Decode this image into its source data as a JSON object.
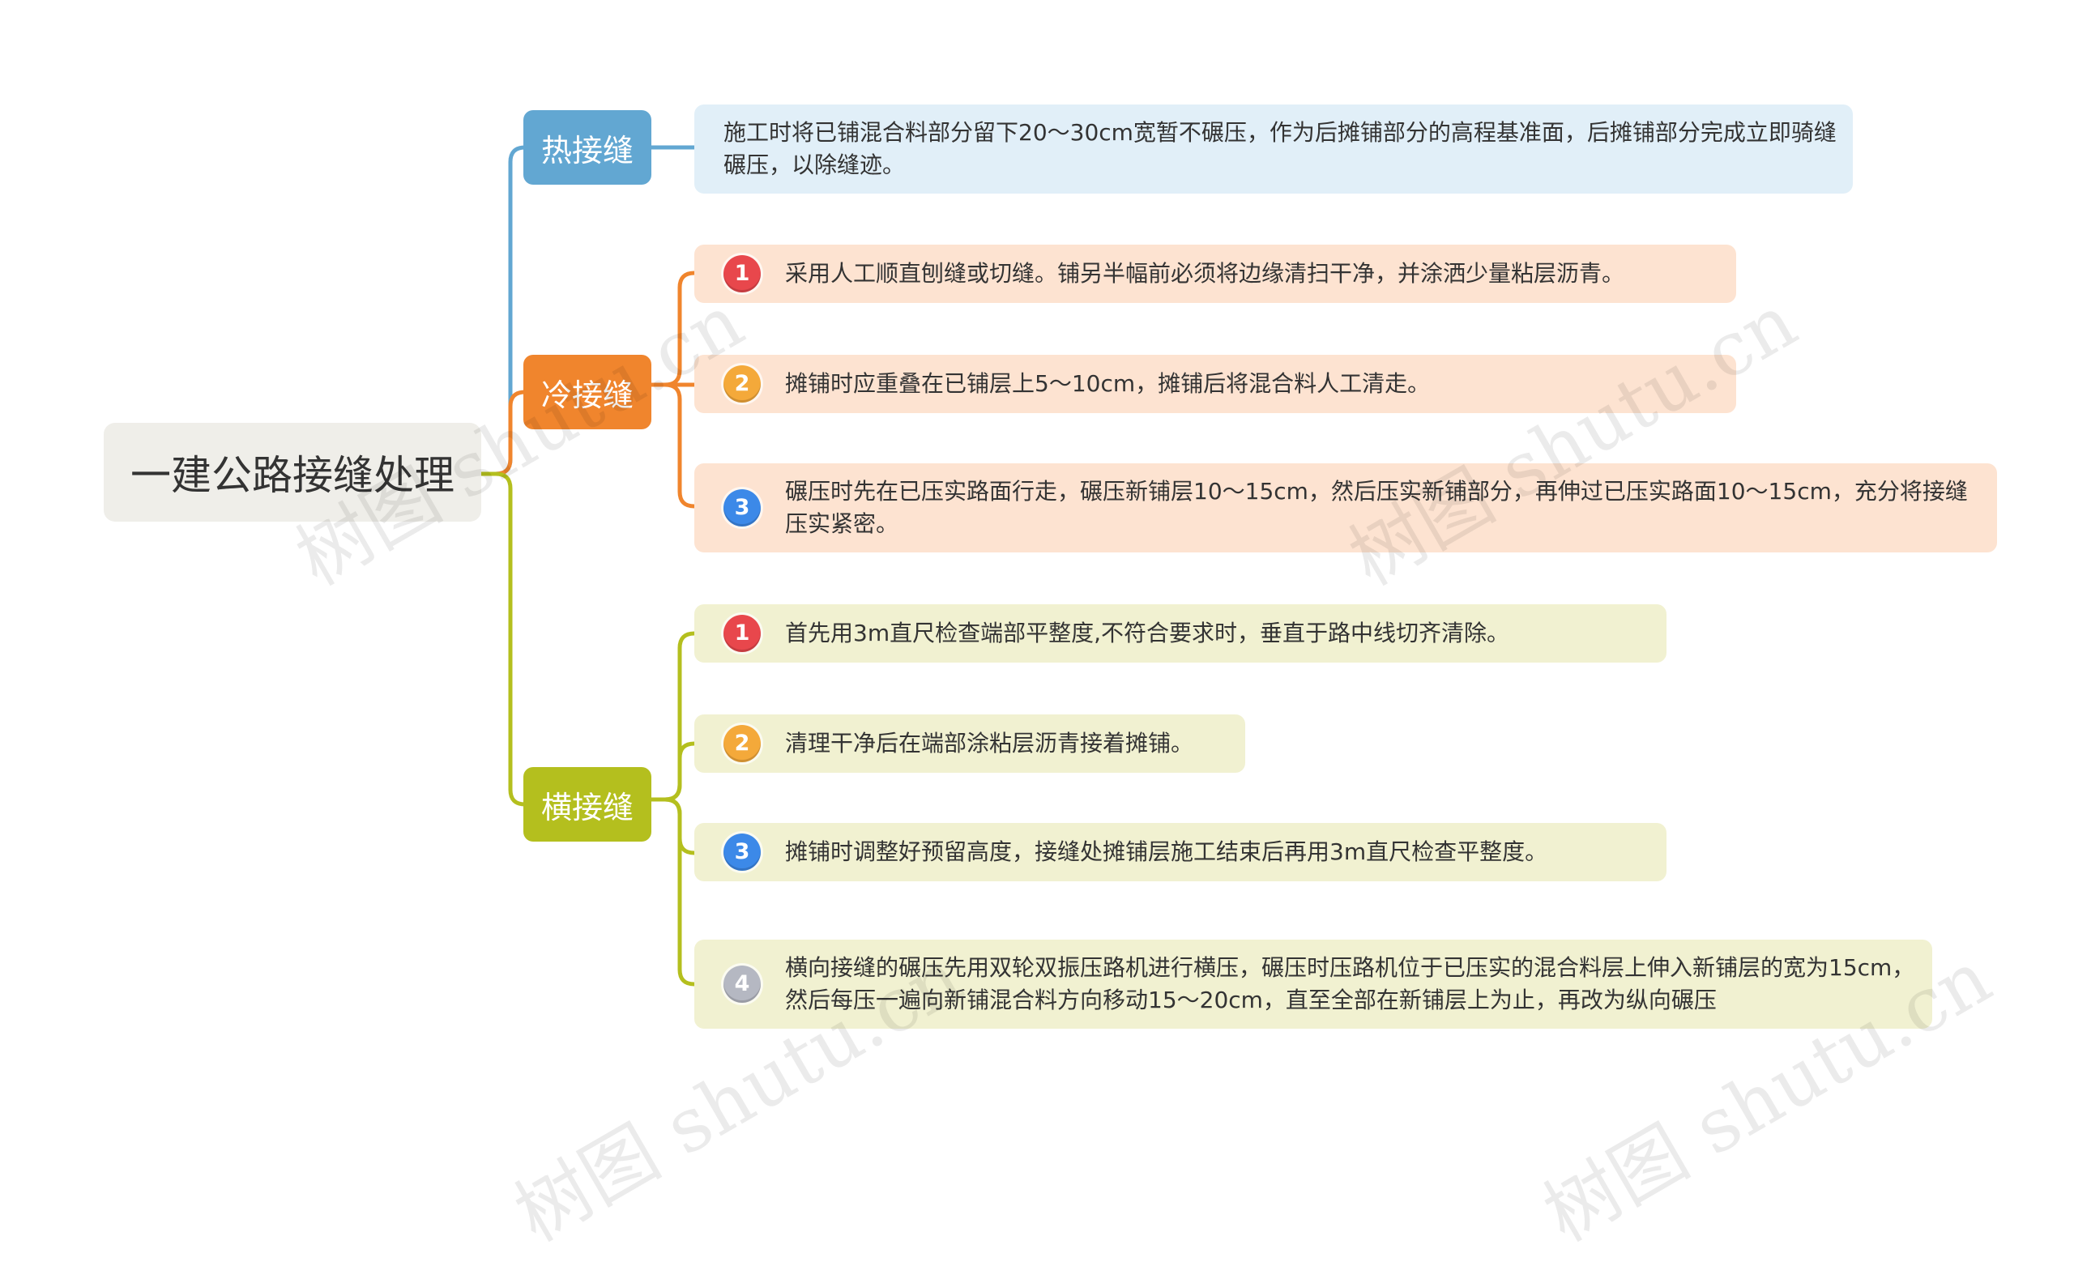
{
  "root": {
    "label": "一建公路接缝处理"
  },
  "colors": {
    "hot": "#62a7d2",
    "cold": "#f0852d",
    "trans": "#b4bf1e",
    "red": "#e8474c",
    "orange": "#f4a93a",
    "blue": "#3c89e8",
    "grey": "#b5b8c2"
  },
  "branches": {
    "hot": {
      "label": "热接缝",
      "items": [
        {
          "text": "施工时将已铺混合料部分留下20～30cm宽暂不碾压，作为后摊铺部分的高程基准面，后摊铺部分完成立即骑缝碾压，以除缝迹。"
        }
      ]
    },
    "cold": {
      "label": "冷接缝",
      "items": [
        {
          "num": "1",
          "text": "采用人工顺直刨缝或切缝。铺另半幅前必须将边缘清扫干净，并涂洒少量粘层沥青。"
        },
        {
          "num": "2",
          "text": "摊铺时应重叠在已铺层上5～10cm，摊铺后将混合料人工清走。"
        },
        {
          "num": "3",
          "text": "碾压时先在已压实路面行走，碾压新铺层10～15cm，然后压实新铺部分，再伸过已压实路面10～15cm，充分将接缝压实紧密。"
        }
      ]
    },
    "trans": {
      "label": "横接缝",
      "items": [
        {
          "num": "1",
          "text": "首先用3m直尺检查端部平整度,不符合要求时，垂直于路中线切齐清除。"
        },
        {
          "num": "2",
          "text": "清理干净后在端部涂粘层沥青接着摊铺。"
        },
        {
          "num": "3",
          "text": "摊铺时调整好预留高度，接缝处摊铺层施工结束后再用3m直尺检查平整度。"
        },
        {
          "num": "4",
          "text": "横向接缝的碾压先用双轮双振压路机进行横压，碾压时压路机位于已压实的混合料层上伸入新铺层的宽为15cm，然后每压一遍向新铺混合料方向移动15～20cm，直至全部在新铺层上为止，再改为纵向碾压"
        }
      ]
    }
  },
  "watermark": "树图 shutu.cn"
}
